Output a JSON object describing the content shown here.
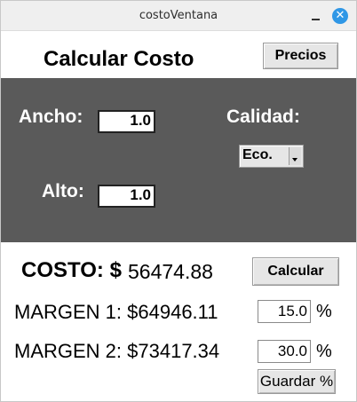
{
  "window": {
    "title": "costoVentana",
    "minimize_icon": "minimize-icon",
    "close_icon": "close-icon",
    "accent": "#2f97e6"
  },
  "header": {
    "title": "Calcular Costo",
    "precios_label": "Precios"
  },
  "inputs": {
    "ancho_label": "Ancho:",
    "ancho_value": "1.0",
    "alto_label": "Alto:",
    "alto_value": "1.0",
    "calidad_label": "Calidad:",
    "calidad_value": "Eco.",
    "panel_color": "#5a5a5a"
  },
  "results": {
    "costo_label": "COSTO: $",
    "costo_value": "56474.88",
    "calcular_label": "Calcular",
    "margen1_label": "MARGEN 1: $",
    "margen1_value": "64946.11",
    "margen1_pct": "15.0",
    "margen2_label": "MARGEN 2: $",
    "margen2_value": "73417.34",
    "margen2_pct": "30.0",
    "pct_symbol": "%",
    "guardar_label": "Guardar %"
  }
}
